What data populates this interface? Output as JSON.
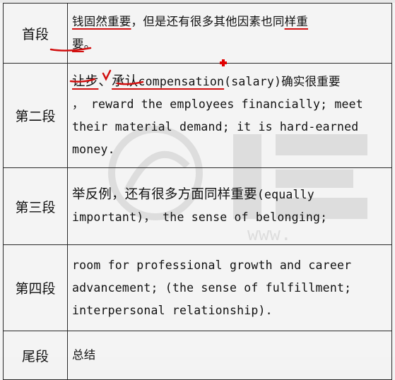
{
  "rows": [
    {
      "label": "首段",
      "content_parts": [
        "钱固然重要",
        "，但是还有很多其他因素也同",
        "样重",
        "要",
        "。"
      ]
    },
    {
      "label": "第二段",
      "cn_parts": [
        "让步",
        "、",
        "承认"
      ],
      "en_mark": "compensation",
      "line_rest": "(salary)确实很重要",
      "body": "， reward the employees financially; meet their material demand; it is hard-earned money."
    },
    {
      "label": "第三段",
      "cn": "举反例，还有很多方面同样重要",
      "body": "(equally important)， the sense of belonging;"
    },
    {
      "label": "第四段",
      "body": "room for professional growth and career advancement; (the sense of fulfillment; interpersonal relationship)."
    },
    {
      "label": "尾段",
      "cn": "总结"
    }
  ],
  "watermark": {
    "icon": "logo-watermark-icon",
    "text": "www."
  },
  "colors": {
    "annotation_red": "#d21010",
    "border": "#2a2a2a",
    "background": "#f4f4f4"
  }
}
